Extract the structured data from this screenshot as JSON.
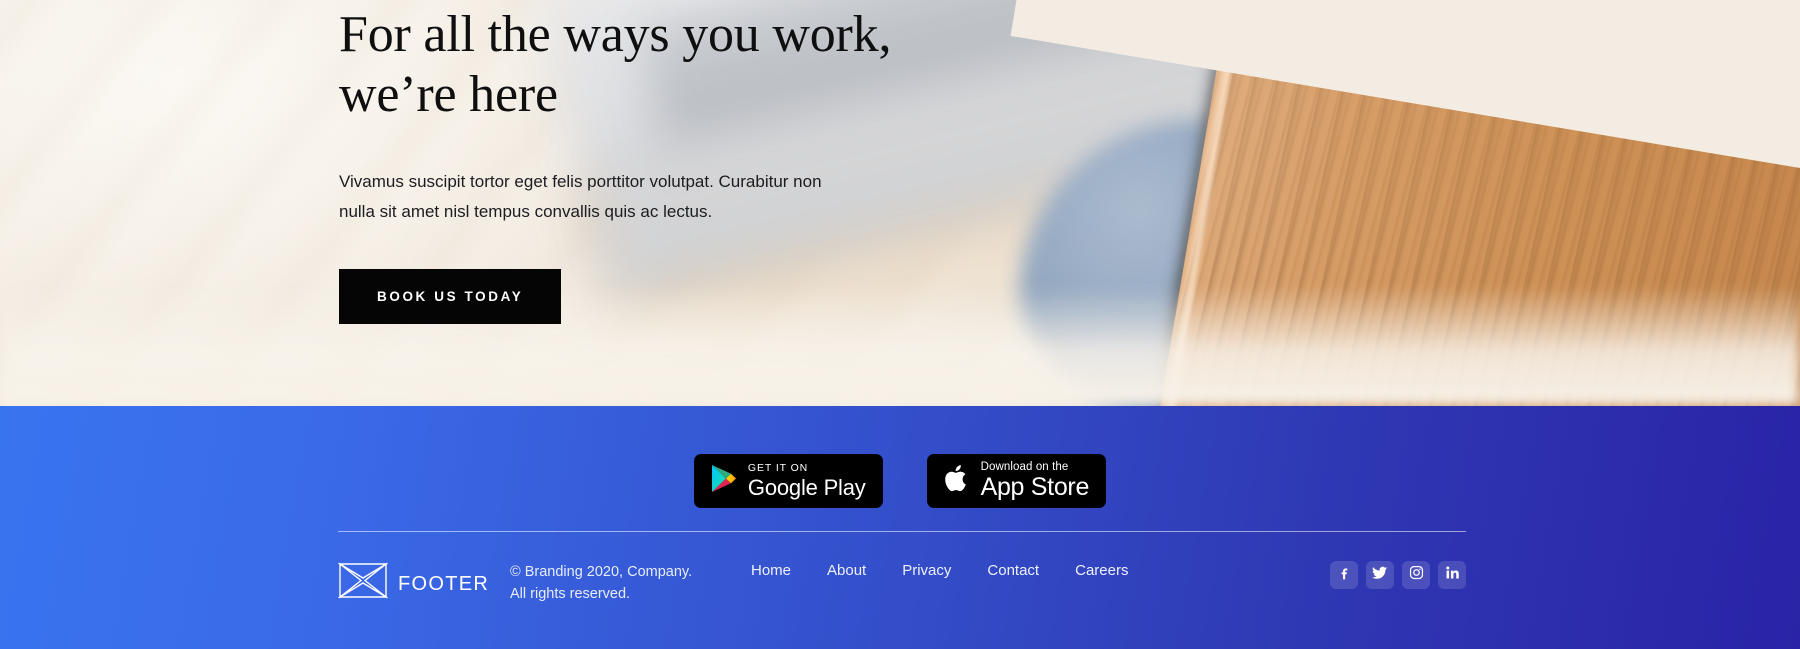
{
  "hero": {
    "title": "For all the ways you work, we’re here",
    "subtitle": "Vivamus suscipit tortor eget felis porttitor volutpat. Curabitur non nulla sit amet nisl tempus convallis quis ac lectus.",
    "cta_label": "BOOK US TODAY",
    "background_description": "blurred photo of a desk with keyboard, blue-grey mouse and wooden panel"
  },
  "footer": {
    "background_gradient_from": "#3974ef",
    "background_gradient_to": "#2a23a7",
    "store_badges": [
      {
        "name": "google-play",
        "small": "GET IT ON",
        "big": "Google Play"
      },
      {
        "name": "app-store",
        "small": "Download on the",
        "big": "App Store"
      }
    ],
    "brand": {
      "logo": "butterfly-logo",
      "name": "FOOTER"
    },
    "copyright_line1": "© Branding 2020, Company.",
    "copyright_line2": "All rights reserved.",
    "nav": [
      {
        "label": "Home"
      },
      {
        "label": "About"
      },
      {
        "label": "Privacy"
      },
      {
        "label": "Contact"
      },
      {
        "label": "Careers"
      }
    ],
    "socials": [
      {
        "name": "facebook-icon"
      },
      {
        "name": "twitter-icon"
      },
      {
        "name": "instagram-icon"
      },
      {
        "name": "linkedin-icon"
      }
    ]
  }
}
